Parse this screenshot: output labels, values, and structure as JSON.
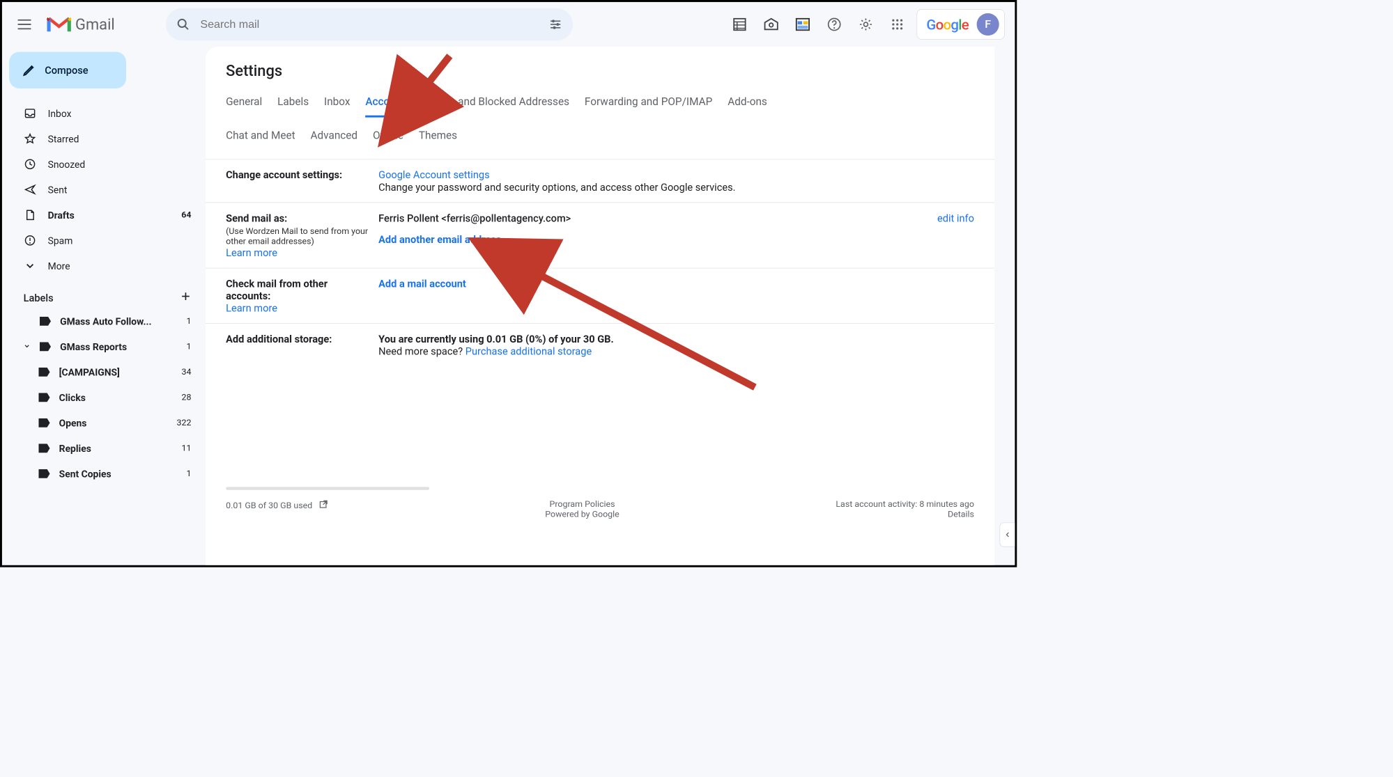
{
  "header": {
    "product": "Gmail",
    "search_placeholder": "Search mail",
    "avatar_initial": "F",
    "google": "Google"
  },
  "compose": {
    "label": "Compose"
  },
  "nav": {
    "inbox": "Inbox",
    "starred": "Starred",
    "snoozed": "Snoozed",
    "sent": "Sent",
    "drafts": "Drafts",
    "drafts_count": "64",
    "spam": "Spam",
    "more": "More"
  },
  "labels": {
    "header": "Labels",
    "items": [
      {
        "name": "GMass Auto Follow...",
        "count": "1"
      },
      {
        "name": "GMass Reports",
        "count": "1"
      },
      {
        "name": "[CAMPAIGNS]",
        "count": "34"
      },
      {
        "name": "Clicks",
        "count": "28"
      },
      {
        "name": "Opens",
        "count": "322"
      },
      {
        "name": "Replies",
        "count": "11"
      },
      {
        "name": "Sent Copies",
        "count": "1"
      }
    ]
  },
  "settings": {
    "title": "Settings",
    "tabs_row1": [
      "General",
      "Labels",
      "Inbox",
      "Accounts",
      "Filters and Blocked Addresses",
      "Forwarding and POP/IMAP",
      "Add-ons"
    ],
    "tabs_row2": [
      "Chat and Meet",
      "Advanced",
      "Offline",
      "Themes"
    ],
    "active_tab": "Accounts",
    "change_account": {
      "title": "Change account settings:",
      "link": "Google Account settings",
      "desc": "Change your password and security options, and access other Google services."
    },
    "send_as": {
      "title": "Send mail as:",
      "sub": "(Use Wordzen Mail to send from your other email addresses)",
      "learn": "Learn more",
      "identity": "Ferris Pollent <ferris@pollentagency.com>",
      "edit": "edit info",
      "add": "Add another email address"
    },
    "check_mail": {
      "title": "Check mail from other accounts:",
      "learn": "Learn more",
      "add": "Add a mail account"
    },
    "storage": {
      "title": "Add additional storage:",
      "usage": "You are currently using 0.01 GB (0%) of your 30 GB.",
      "need": "Need more space? ",
      "purchase": "Purchase additional storage"
    }
  },
  "footer": {
    "storage": "0.01 GB of 30 GB used",
    "policies": "Program Policies",
    "powered": "Powered by Google",
    "activity": "Last account activity: 8 minutes ago",
    "details": "Details"
  }
}
